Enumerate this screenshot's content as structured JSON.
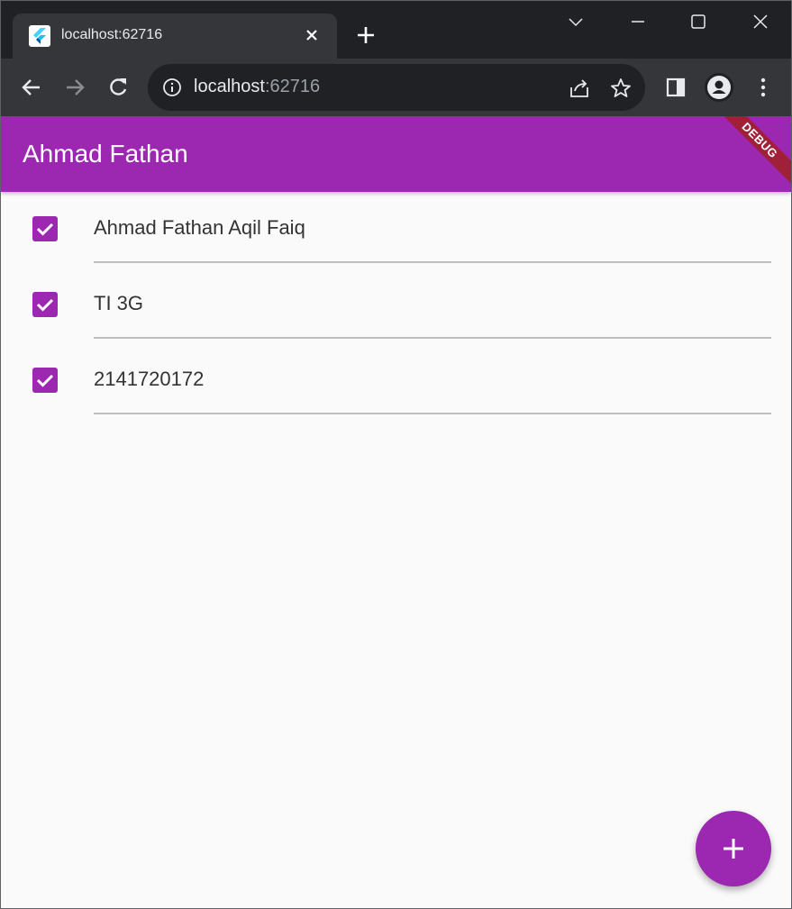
{
  "browser": {
    "tab_title": "localhost:62716",
    "url_host": "localhost",
    "url_port": ":62716"
  },
  "app": {
    "title": "Ahmad Fathan",
    "banner": "DEBUG",
    "accent_color": "#9c27b0"
  },
  "items": [
    {
      "label": "Ahmad Fathan Aqil Faiq",
      "checked": true
    },
    {
      "label": "TI 3G",
      "checked": true
    },
    {
      "label": "2141720172",
      "checked": true
    }
  ],
  "fab": {
    "icon": "plus-icon"
  }
}
